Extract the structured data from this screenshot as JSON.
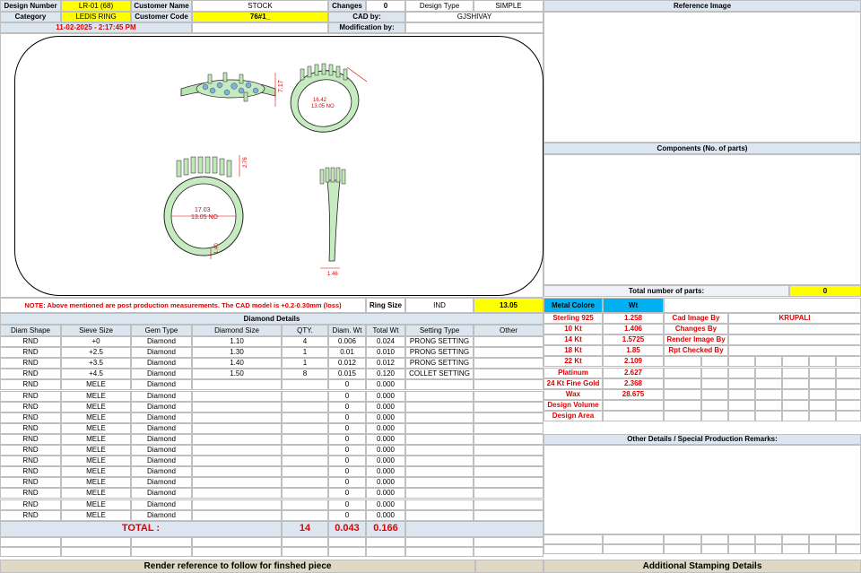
{
  "header": {
    "design_number_label": "Design Number",
    "design_number": "LR-01 (68)",
    "customer_name_label": "Customer Name",
    "customer_name": "STOCK",
    "changes_label": "Changes",
    "changes": "0",
    "design_type_label": "Design Type",
    "design_type": "SIMPLE",
    "category_label": "Category",
    "category": "LEDIS RING",
    "customer_code_label": "Customer Code",
    "customer_code": "76#1_",
    "cad_by_label": "CAD by:",
    "cad_by": "GJSHIVAY",
    "datetime": "11-02-2025 - 2:17:45 PM",
    "modification_label": "Modification by:",
    "modification": ""
  },
  "reference_image": {
    "title": "Reference Image"
  },
  "components": {
    "title": "Components (No. of parts)",
    "total_label": "Total number of parts:",
    "total": "0"
  },
  "drawing": {
    "dim_width": "7.17",
    "dim_size": "16.42",
    "dim_size_no": "13.05 NO",
    "dim_height": "2.76",
    "dim_inner": "17.03",
    "dim_inner_no": "13.05 NO",
    "dim_shank": "1.40",
    "dim_side": "1.46"
  },
  "note": {
    "text": "NOTE: Above mentioned are post production measurements. The CAD model is +0.2-0.30mm (loss)",
    "ring_size_label": "Ring Size",
    "ring_size_system": "IND",
    "ring_size": "13.05"
  },
  "metal": {
    "header_label": "Metal Colore",
    "header_wt": "Wt",
    "rows": [
      {
        "name": "Sterling 925",
        "wt": "1.258"
      },
      {
        "name": "10 Kt",
        "wt": "1.406"
      },
      {
        "name": "14 Kt",
        "wt": "1.5725"
      },
      {
        "name": "18 Kt",
        "wt": "1.85"
      },
      {
        "name": "22 Kt",
        "wt": "2.109"
      },
      {
        "name": "Platinum",
        "wt": "2.627"
      },
      {
        "name": "24 Kt Fine Gold",
        "wt": "2.368"
      },
      {
        "name": "Wax",
        "wt": "28.675"
      },
      {
        "name": "Design Volume",
        "wt": ""
      },
      {
        "name": "Design Area",
        "wt": ""
      }
    ]
  },
  "credits": [
    {
      "label": "Cad Image By",
      "value": "KRUPALI"
    },
    {
      "label": "Changes By",
      "value": ""
    },
    {
      "label": "Render Image By",
      "value": ""
    },
    {
      "label": "Rpt Checked By",
      "value": ""
    }
  ],
  "other_details": {
    "title": "Other Details / Special Production Remarks:"
  },
  "diamond": {
    "title": "Diamond Details",
    "headers": [
      "Diam Shape",
      "Sieve Size",
      "Gem Type",
      "Diamond Size",
      "QTY.",
      "Diam. Wt",
      "Total Wt",
      "Setting Type",
      "Other"
    ],
    "rows": [
      [
        "RND",
        "+0",
        "Diamond",
        "1.10",
        "4",
        "0.006",
        "0.024",
        "PRONG SETTING",
        ""
      ],
      [
        "RND",
        "+2.5",
        "Diamond",
        "1.30",
        "1",
        "0.01",
        "0.010",
        "PRONG SETTING",
        ""
      ],
      [
        "RND",
        "+3.5",
        "Diamond",
        "1.40",
        "1",
        "0.012",
        "0.012",
        "PRONG SETTING",
        ""
      ],
      [
        "RND",
        "+4.5",
        "Diamond",
        "1.50",
        "8",
        "0.015",
        "0.120",
        "COLLET SETTING",
        ""
      ],
      [
        "RND",
        "MELE",
        "Diamond",
        "",
        "",
        "0",
        "0.000",
        "",
        ""
      ],
      [
        "RND",
        "MELE",
        "Diamond",
        "",
        "",
        "0",
        "0.000",
        "",
        ""
      ],
      [
        "RND",
        "MELE",
        "Diamond",
        "",
        "",
        "0",
        "0.000",
        "",
        ""
      ],
      [
        "RND",
        "MELE",
        "Diamond",
        "",
        "",
        "0",
        "0.000",
        "",
        ""
      ],
      [
        "RND",
        "MELE",
        "Diamond",
        "",
        "",
        "0",
        "0.000",
        "",
        ""
      ],
      [
        "RND",
        "MELE",
        "Diamond",
        "",
        "",
        "0",
        "0.000",
        "",
        ""
      ],
      [
        "RND",
        "MELE",
        "Diamond",
        "",
        "",
        "0",
        "0.000",
        "",
        ""
      ],
      [
        "RND",
        "MELE",
        "Diamond",
        "",
        "",
        "0",
        "0.000",
        "",
        ""
      ],
      [
        "RND",
        "MELE",
        "Diamond",
        "",
        "",
        "0",
        "0.000",
        "",
        ""
      ],
      [
        "RND",
        "MELE",
        "Diamond",
        "",
        "",
        "0",
        "0.000",
        "",
        ""
      ],
      [
        "RND",
        "MELE",
        "Diamond",
        "",
        "",
        "0",
        "0.000",
        "",
        ""
      ],
      [
        "RND",
        "MELE",
        "Diamond",
        "",
        "",
        "0",
        "0.000",
        "",
        ""
      ],
      [
        "RND",
        "MELE",
        "Diamond",
        "",
        "",
        "0",
        "0.000",
        "",
        ""
      ]
    ],
    "total_label": "TOTAL :",
    "total_qty": "14",
    "total_diam_wt": "0.043",
    "total_wt": "0.166"
  },
  "footer": {
    "left": "Render reference to follow for finshed piece",
    "right": "Additional Stamping Details"
  }
}
